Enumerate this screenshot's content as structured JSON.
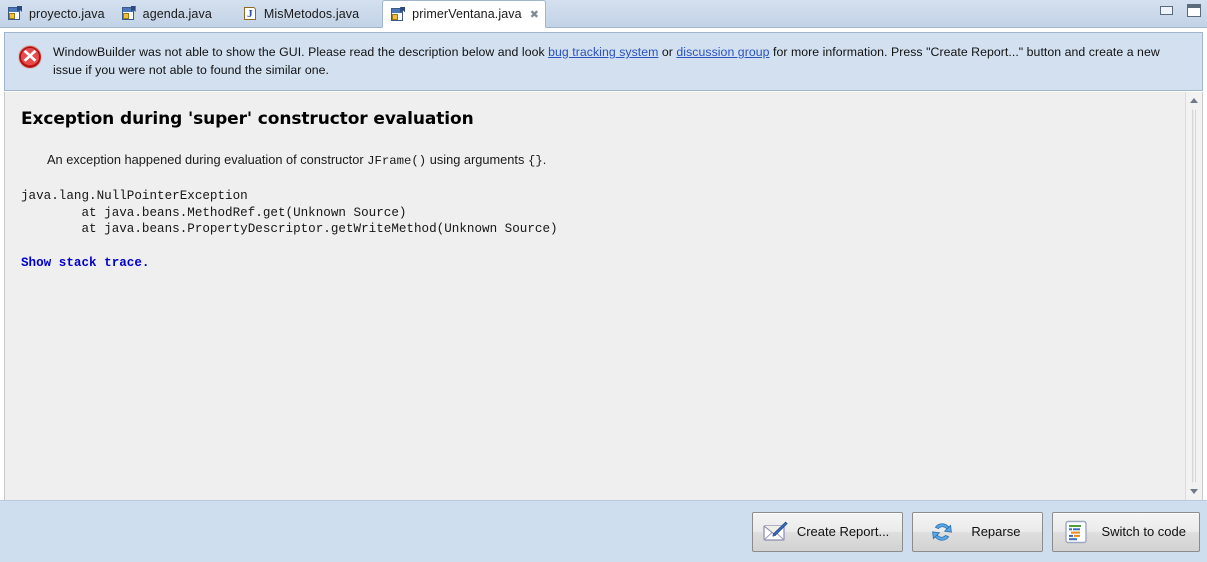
{
  "window": {
    "minimize_label": "Minimize",
    "maximize_label": "Maximize"
  },
  "tabs": [
    {
      "label": "proyecto.java",
      "icon": "java-class-icon",
      "active": false,
      "closable": false
    },
    {
      "label": "agenda.java",
      "icon": "java-class-icon",
      "active": false,
      "closable": false
    },
    {
      "label": "MisMetodos.java",
      "icon": "java-file-icon",
      "active": false,
      "closable": false
    },
    {
      "label": "primerVentana.java",
      "icon": "java-class-icon",
      "active": true,
      "closable": true,
      "close_glyph": "✖"
    }
  ],
  "banner": {
    "icon": "error-icon",
    "text_1": "WindowBuilder was not able to show the GUI. Please read the description below and look ",
    "link_1": "bug tracking system",
    "text_2": " or ",
    "link_2": "discussion group",
    "text_3": " for more information. Press \"Create Report...\" button and create a new issue if you were not able to found the similar one.",
    "background": "#d2e0f0"
  },
  "content": {
    "title": "Exception during 'super' constructor evaluation",
    "description_pre": "An exception happened during evaluation of constructor ",
    "description_code_1": "JFrame()",
    "description_mid": " using arguments ",
    "description_code_2": "{}",
    "description_post": ".",
    "stack_trace": "java.lang.NullPointerException\n        at java.beans.MethodRef.get(Unknown Source)\n        at java.beans.PropertyDescriptor.getWriteMethod(Unknown Source)",
    "show_stack_trace_link": "Show stack trace.",
    "link_color": "#0000cc",
    "background": "#efefef"
  },
  "scrollbar": {
    "up_arrow": "scroll-up-arrow",
    "down_arrow": "scroll-down-arrow"
  },
  "footer": {
    "background": "#cedeee",
    "buttons": [
      {
        "label": "Create Report...",
        "icon": "envelope-pen-icon"
      },
      {
        "label": "Reparse",
        "icon": "refresh-icon"
      },
      {
        "label": "Switch to code",
        "icon": "source-code-icon"
      }
    ]
  }
}
